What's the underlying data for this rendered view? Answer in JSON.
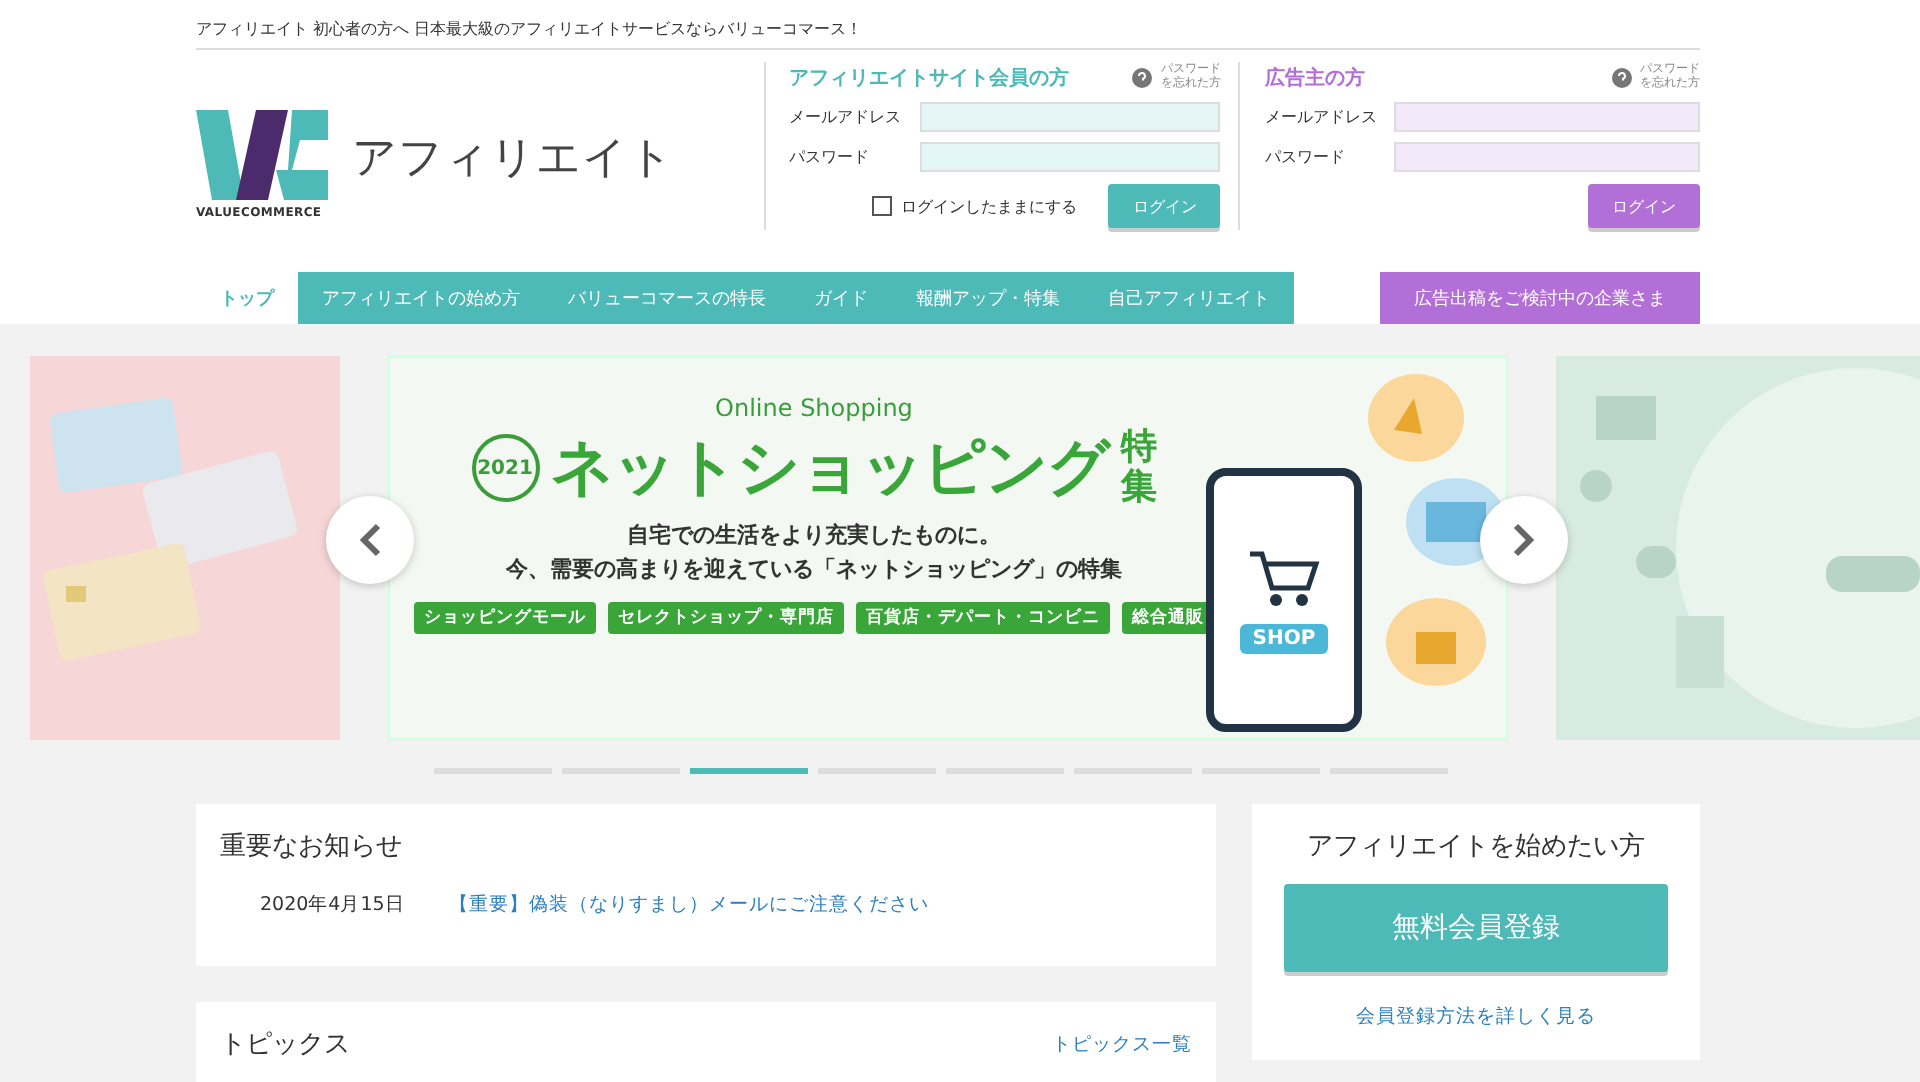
{
  "tagline": "アフィリエイト 初心者の方へ 日本最大級のアフィリエイトサービスならバリューコマース！",
  "logo": {
    "brand": "VALUECOMMERCE",
    "title": "アフィリエイト"
  },
  "login_panels": [
    {
      "kind": "affiliate",
      "title": "アフィリエイトサイト会員の方",
      "forgot": "パスワードを忘れた方",
      "email_label": "メールアドレス",
      "password_label": "パスワード",
      "remember": {
        "label": "ログインしたままにする",
        "checked": false
      },
      "button": "ログイン"
    },
    {
      "kind": "advertiser",
      "title": "広告主の方",
      "forgot": "パスワードを忘れた方",
      "email_label": "メールアドレス",
      "password_label": "パスワード",
      "button": "ログイン"
    }
  ],
  "nav": [
    {
      "label": "トップ",
      "selected": true
    },
    {
      "label": "アフィリエイトの始め方",
      "selected": false
    },
    {
      "label": "バリューコマースの特長",
      "selected": false
    },
    {
      "label": "ガイド",
      "selected": false
    },
    {
      "label": "報酬アップ・特集",
      "selected": false
    },
    {
      "label": "自己アフィリエイト",
      "selected": false
    }
  ],
  "nav_advertiser": "広告出稿をご検討中の企業さま",
  "banner": {
    "kicker": "Online Shopping",
    "year": "2021",
    "headline": "ネットショッピング",
    "headline_suffix": "特集",
    "lines": [
      "自宅での生活をより充実したものに。",
      "今、需要の高まりを迎えている「ネットショッピング」の特集"
    ],
    "shop_label": "SHOP",
    "tags": [
      "ショッピングモール",
      "セレクトショップ・専門店",
      "百貨店・デパート・コンビニ",
      "総合通販"
    ]
  },
  "carousel_dots": [
    {
      "selected": false
    },
    {
      "selected": false
    },
    {
      "selected": true
    },
    {
      "selected": false
    },
    {
      "selected": false
    },
    {
      "selected": false
    },
    {
      "selected": false
    },
    {
      "selected": false
    }
  ],
  "notices": {
    "title": "重要なお知らせ",
    "items": [
      {
        "date": "2020年4月15日",
        "text": "【重要】偽装（なりすまし）メールにご注意ください"
      }
    ]
  },
  "topics": {
    "title": "トピックス",
    "link": "トピックス一覧"
  },
  "signup": {
    "title": "アフィリエイトを始めたい方",
    "button": "無料会員登録",
    "link": "会員登録方法を詳しく見る"
  }
}
